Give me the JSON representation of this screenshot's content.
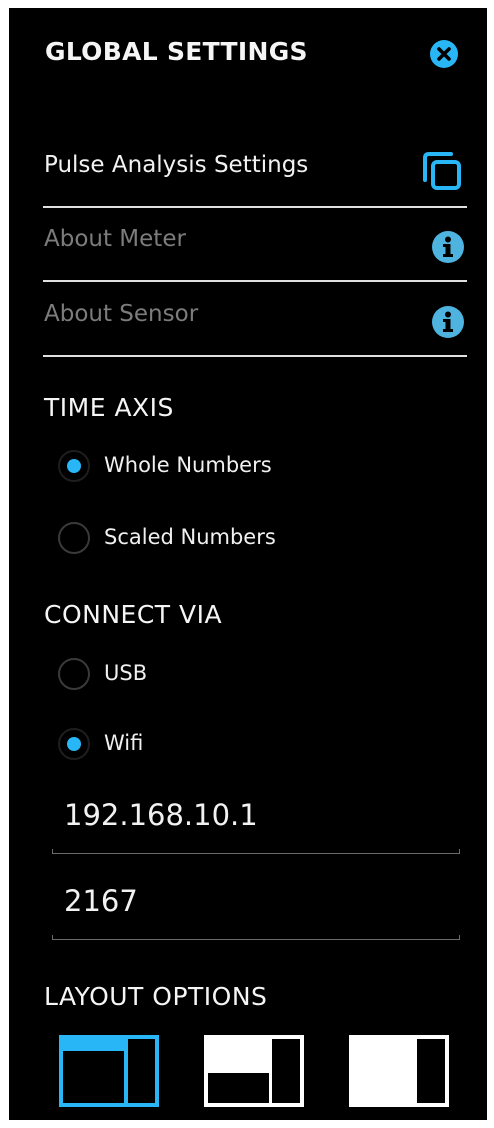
{
  "header": {
    "title": "GLOBAL SETTINGS",
    "close_icon": "close-circle-icon",
    "accent": "#29b6f6"
  },
  "menu": [
    {
      "label": "Pulse Analysis Settings",
      "icon": "copy-icon",
      "state": "active"
    },
    {
      "label": "About Meter",
      "icon": "info-icon",
      "state": "dim"
    },
    {
      "label": "About Sensor",
      "icon": "info-icon",
      "state": "dim"
    }
  ],
  "time_axis": {
    "heading": "TIME AXIS",
    "options": [
      {
        "label": "Whole Numbers",
        "checked": true
      },
      {
        "label": "Scaled Numbers",
        "checked": false
      }
    ]
  },
  "connect_via": {
    "heading": "CONNECT VIA",
    "options": [
      {
        "label": "USB",
        "checked": false
      },
      {
        "label": "Wifi",
        "checked": true
      }
    ],
    "ip_address": "192.168.10.1",
    "port": "2167"
  },
  "layout_options": {
    "heading": "LAYOUT OPTIONS",
    "options": [
      {
        "name": "layout-option-1",
        "selected": true
      },
      {
        "name": "layout-option-2",
        "selected": false
      },
      {
        "name": "layout-option-3",
        "selected": false
      }
    ]
  }
}
